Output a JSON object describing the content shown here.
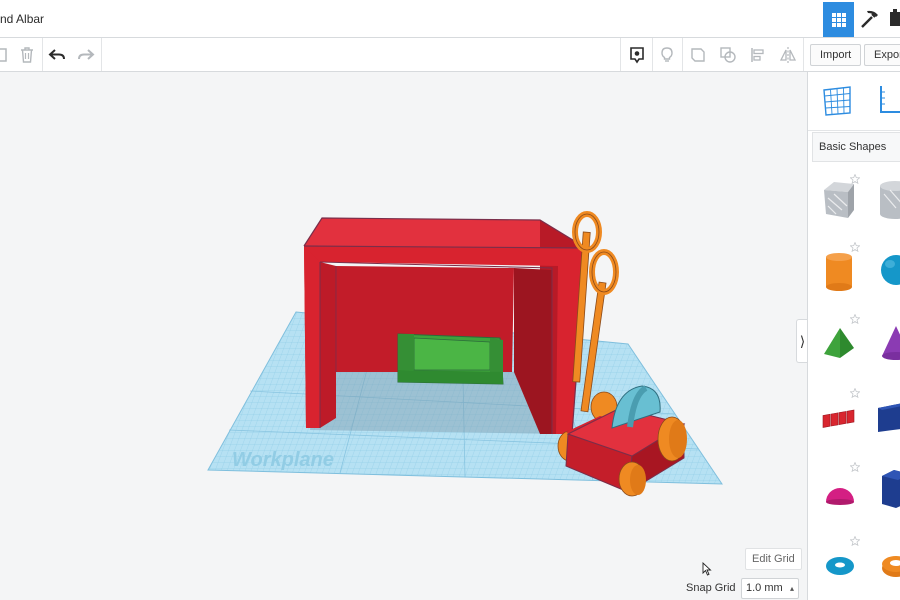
{
  "header": {
    "title": "nd Albar"
  },
  "toolbar": {
    "import_label": "Import",
    "export_label": "Expor"
  },
  "panel": {
    "category": "Basic Shapes",
    "shapes": [
      {
        "name": "box",
        "color": "#b9bec4"
      },
      {
        "name": "cylinder-hole",
        "color": "#b9bec4"
      },
      {
        "name": "cylinder",
        "color": "#ef8a22"
      },
      {
        "name": "sphere",
        "color": "#1597c9"
      },
      {
        "name": "roof",
        "color": "#3ea33c"
      },
      {
        "name": "cone",
        "color": "#8b3bb3"
      },
      {
        "name": "text",
        "color": "#d8262f"
      },
      {
        "name": "wedge",
        "color": "#1e3d8f"
      },
      {
        "name": "half-sphere",
        "color": "#d41f83"
      },
      {
        "name": "polygon",
        "color": "#1e3d8f"
      },
      {
        "name": "torus",
        "color": "#1597c9"
      },
      {
        "name": "tube",
        "color": "#ef8a22"
      }
    ]
  },
  "workplane": {
    "label": "Workplane"
  },
  "bottom": {
    "edit_grid_label": "Edit Grid",
    "snap_grid_label": "Snap Grid",
    "snap_grid_value": "1.0 mm"
  },
  "colors": {
    "accent": "#2d8ce0",
    "workplane": "#a9dbef",
    "house": "#d8232f",
    "sofa": "#3ea33c",
    "orange": "#ef8a22",
    "car_top": "#68bfd2"
  }
}
